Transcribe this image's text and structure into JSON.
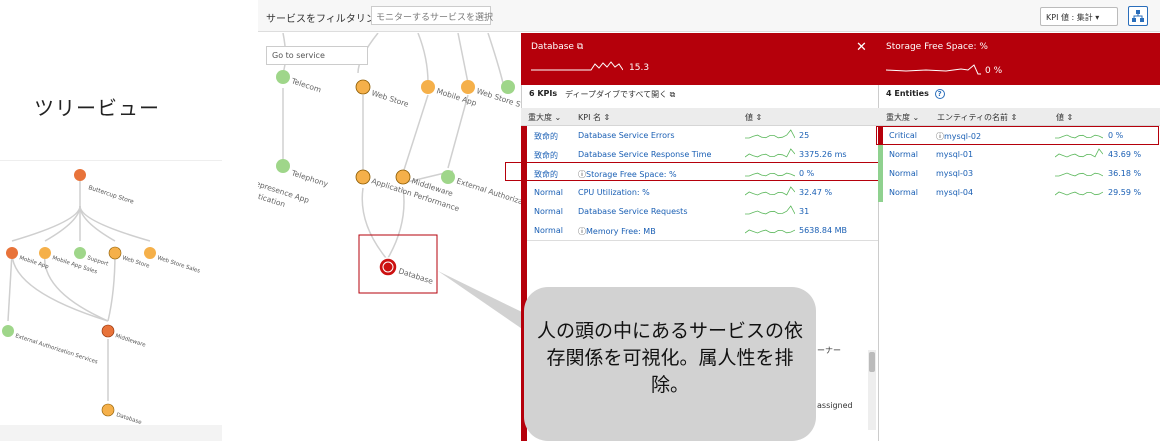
{
  "left": {
    "title": "ツリービュー",
    "nodes": [
      "Buttercup Store",
      "Mobile App",
      "Mobile App Sales",
      "Support",
      "Web Store",
      "Web Store Sales",
      "External Authorization Services",
      "Middleware",
      "Database"
    ]
  },
  "toolbar": {
    "filter_label": "サービスをフィルタリング",
    "filter_placeholder": "モニターするサービスを選択",
    "kpi_button": "KPI 値 : 集計 ▾"
  },
  "graph": {
    "goto_placeholder": "Go to service",
    "nodes": [
      "Telecom",
      "Web Store",
      "Mobile App",
      "Web Store S",
      "Telephony",
      "lepresence App",
      "ntication",
      "Application Performance",
      "Middleware",
      "External Authorizati",
      "Database"
    ]
  },
  "db_panel": {
    "title": "Database",
    "value": "15.3",
    "kpi_count": "6 KPIs",
    "drill_label": "ディープダイブですべて開く",
    "headers": {
      "severity": "重大度",
      "kpi_name": "KPI 名",
      "value": "値"
    },
    "rows": [
      {
        "severity": "致命的",
        "name": "Database Service Errors",
        "value": "25",
        "color": "#b5000b",
        "warn": false
      },
      {
        "severity": "致命的",
        "name": "Database Service Response Time",
        "value": "3375.26 ms",
        "color": "#b5000b",
        "warn": false
      },
      {
        "severity": "致命的",
        "name": "Storage Free Space: %",
        "value": "0 %",
        "color": "#b5000b",
        "warn": true
      },
      {
        "severity": "Normal",
        "name": "CPU Utilization: %",
        "value": "32.47 %",
        "color": "#8fd18f",
        "warn": false
      },
      {
        "severity": "Normal",
        "name": "Database Service Requests",
        "value": "31",
        "color": "#8fd18f",
        "warn": false
      },
      {
        "severity": "Normal",
        "name": "Memory Free: MB",
        "value": "5638.84 MB",
        "color": "#8fd18f",
        "warn": true
      }
    ],
    "partial_text_1": "ーナー",
    "partial_text_2": "assigned"
  },
  "storage_panel": {
    "title": "Storage Free Space: %",
    "value": "0 %",
    "entity_count": "4 Entities",
    "headers": {
      "severity": "重大度",
      "entity_name": "エンティティの名前",
      "value": "値"
    },
    "rows": [
      {
        "severity": "Critical",
        "name": "mysql-02",
        "value": "0 %",
        "color": "#b5000b",
        "warn": true
      },
      {
        "severity": "Normal",
        "name": "mysql-01",
        "value": "43.69 %",
        "color": "#8fd18f",
        "warn": false
      },
      {
        "severity": "Normal",
        "name": "mysql-03",
        "value": "36.18 %",
        "color": "#8fd18f",
        "warn": false
      },
      {
        "severity": "Normal",
        "name": "mysql-04",
        "value": "29.59 %",
        "color": "#8fd18f",
        "warn": false
      }
    ]
  },
  "callout": {
    "text": "人の頭の中にあるサービスの依存関係を可視化。属人性を排除。"
  }
}
